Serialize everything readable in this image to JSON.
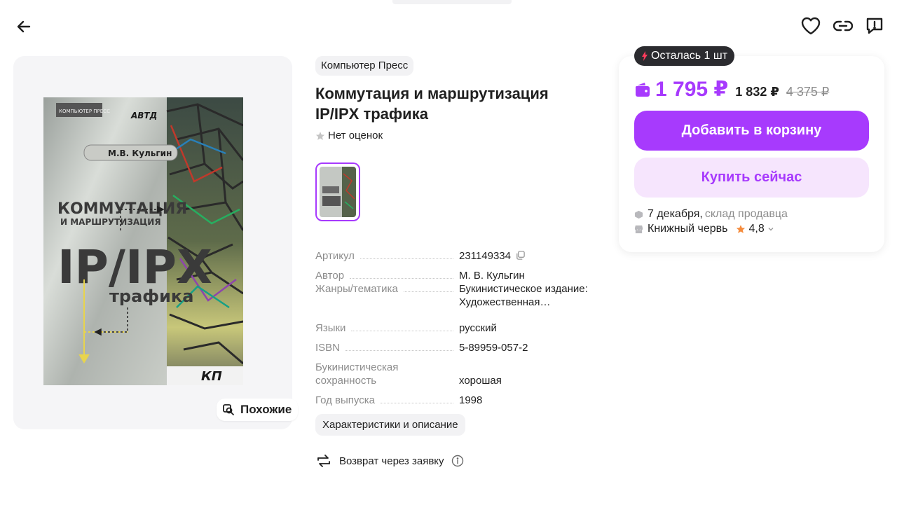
{
  "header": {
    "back_icon": "arrow-left-icon",
    "icons": [
      "heart-icon",
      "link-icon",
      "report-icon"
    ]
  },
  "gallery": {
    "similar_label": "Похожие",
    "cover": {
      "publisher_logo": "КОМПЬЮТЕР ПРЕСС",
      "badge": "АВТД",
      "author": "М.В. Кульгин",
      "title_line1": "КОММУТАЦИЯ",
      "title_line2": "И МАРШРУТИЗАЦИЯ",
      "title_line3": "IP/IPX",
      "title_line4": "трафика",
      "bottom_logo": "КП"
    }
  },
  "product": {
    "brand": "Компьютер Пресс",
    "title": "Коммутация и маршрутизация IP/IPX трафика",
    "rating_text": "Нет оценок"
  },
  "specs": [
    {
      "key": "Артикул",
      "value": "231149334"
    },
    {
      "key": "Автор",
      "value": "М. В. Кульгин"
    },
    {
      "key": "Жанры/тематика",
      "value": "Букинистическое издание: Художественная…"
    },
    {
      "key": "Языки",
      "value": "русский"
    },
    {
      "key": "ISBN",
      "value": "5-89959-057-2"
    },
    {
      "key": "Букинистическая сохранность",
      "value": "хорошая"
    },
    {
      "key": "Год выпуска",
      "value": "1998"
    }
  ],
  "characteristics_label": "Характеристики и описание",
  "return_label": "Возврат через заявку",
  "buy": {
    "stock_badge": "Осталась 1 шт",
    "price": "1 795 ₽",
    "price_card": "1 832 ₽",
    "price_old": "4 375 ₽",
    "cart_button": "Добавить в корзину",
    "buy_now_button": "Купить сейчас",
    "delivery_date": "7 декабря,",
    "delivery_where": "склад продавца",
    "seller_name": "Книжный червь",
    "seller_rating": "4,8"
  },
  "colors": {
    "accent": "#a73afd",
    "accent_light": "#f6e5fd",
    "badge_bg": "#2b2b2f",
    "star": "#f58b3c"
  }
}
